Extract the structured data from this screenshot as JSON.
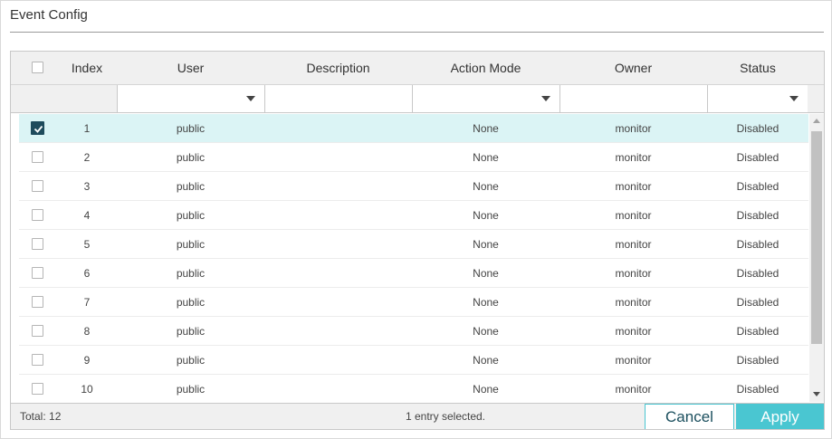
{
  "section": {
    "title": "Event Config"
  },
  "table": {
    "columns": [
      "Index",
      "User",
      "Description",
      "Action Mode",
      "Owner",
      "Status"
    ],
    "rows": [
      {
        "index": "1",
        "user": "public",
        "description": "",
        "action_mode": "None",
        "owner": "monitor",
        "status": "Disabled",
        "checked": true
      },
      {
        "index": "2",
        "user": "public",
        "description": "",
        "action_mode": "None",
        "owner": "monitor",
        "status": "Disabled",
        "checked": false
      },
      {
        "index": "3",
        "user": "public",
        "description": "",
        "action_mode": "None",
        "owner": "monitor",
        "status": "Disabled",
        "checked": false
      },
      {
        "index": "4",
        "user": "public",
        "description": "",
        "action_mode": "None",
        "owner": "monitor",
        "status": "Disabled",
        "checked": false
      },
      {
        "index": "5",
        "user": "public",
        "description": "",
        "action_mode": "None",
        "owner": "monitor",
        "status": "Disabled",
        "checked": false
      },
      {
        "index": "6",
        "user": "public",
        "description": "",
        "action_mode": "None",
        "owner": "monitor",
        "status": "Disabled",
        "checked": false
      },
      {
        "index": "7",
        "user": "public",
        "description": "",
        "action_mode": "None",
        "owner": "monitor",
        "status": "Disabled",
        "checked": false
      },
      {
        "index": "8",
        "user": "public",
        "description": "",
        "action_mode": "None",
        "owner": "monitor",
        "status": "Disabled",
        "checked": false
      },
      {
        "index": "9",
        "user": "public",
        "description": "",
        "action_mode": "None",
        "owner": "monitor",
        "status": "Disabled",
        "checked": false
      },
      {
        "index": "10",
        "user": "public",
        "description": "",
        "action_mode": "None",
        "owner": "monitor",
        "status": "Disabled",
        "checked": false
      }
    ]
  },
  "footer": {
    "total": "Total: 12",
    "selected": "1 entry selected.",
    "cancel_label": "Cancel",
    "apply_label": "Apply"
  },
  "icons": {
    "checkbox_checked": "checkmark-icon",
    "filter_select": "chevron-down-icon",
    "scroll_up": "arrow-up-icon",
    "scroll_down": "arrow-down-icon"
  },
  "colors": {
    "accent": "#4ac6d1",
    "selected_row": "#dbf4f5",
    "checkbox_checked": "#1e4b5c",
    "header_bg": "#f0f0f0"
  }
}
